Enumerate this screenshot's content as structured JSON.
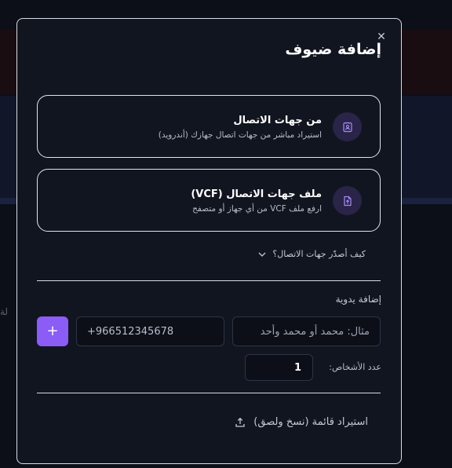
{
  "modal": {
    "title": "إضافة ضيوف",
    "close_icon": "close-icon"
  },
  "options": [
    {
      "title": "من جهات الاتصال",
      "subtitle": "استيراد مباشر من جهات اتصال جهازك (أندرويد)",
      "icon": "contacts-icon"
    },
    {
      "title": "ملف جهات الاتصال (VCF)",
      "subtitle": "ارفع ملف VCF من أي جهاز أو متصفح",
      "icon": "file-upload-icon"
    }
  ],
  "howto": {
    "label": "كيف أصدّر جهات الاتصال؟",
    "icon": "chevron-down-icon"
  },
  "manual": {
    "label": "إضافة يدوية",
    "name_placeholder": "مثال: محمد أو محمد وأحد",
    "phone_placeholder": "+966512345678",
    "add_label": "+",
    "count_label": "عدد الأشخاص:",
    "count_value": "1"
  },
  "import": {
    "label": "استيراد قائمة (نسخ ولصق)",
    "icon": "upload-icon"
  },
  "background": {
    "side_text": "لة"
  },
  "colors": {
    "accent": "#8b5cf6",
    "icon_bg": "#2a2448",
    "modal_bg": "#111520"
  }
}
